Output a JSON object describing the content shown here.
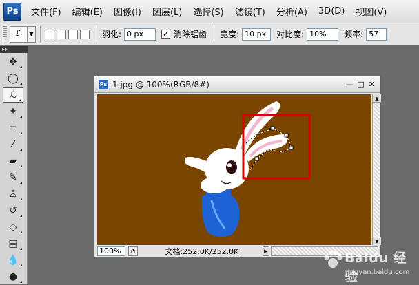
{
  "app": {
    "logo": "Ps"
  },
  "menu": [
    "文件(F)",
    "编辑(E)",
    "图像(I)",
    "图层(L)",
    "选择(S)",
    "滤镜(T)",
    "分析(A)",
    "3D(D)",
    "视图(V)"
  ],
  "window_controls": {
    "minimize": "—",
    "maximize": "□",
    "close": "✕"
  },
  "options_bar": {
    "feather_label": "羽化:",
    "feather_value": "0 px",
    "antialias_label": "消除锯齿",
    "antialias_check": "✓",
    "width_label": "宽度:",
    "width_value": "10 px",
    "contrast_label": "对比度:",
    "contrast_value": "10%",
    "frequency_label": "频率:",
    "frequency_value": "57"
  },
  "tools": [
    {
      "name": "move-tool-icon",
      "glyph": "✥"
    },
    {
      "name": "marquee-tool-icon",
      "glyph": "◯"
    },
    {
      "name": "magnetic-lasso-tool-icon",
      "glyph": "ℒ",
      "active": true
    },
    {
      "name": "magic-wand-tool-icon",
      "glyph": "✦"
    },
    {
      "name": "crop-tool-icon",
      "glyph": "⌗"
    },
    {
      "name": "eyedropper-tool-icon",
      "glyph": "⁄"
    },
    {
      "name": "healing-brush-tool-icon",
      "glyph": "▰"
    },
    {
      "name": "brush-tool-icon",
      "glyph": "✎"
    },
    {
      "name": "clone-stamp-tool-icon",
      "glyph": "♙"
    },
    {
      "name": "history-brush-tool-icon",
      "glyph": "↺"
    },
    {
      "name": "eraser-tool-icon",
      "glyph": "◇"
    },
    {
      "name": "gradient-tool-icon",
      "glyph": "▤"
    },
    {
      "name": "blur-tool-icon",
      "glyph": "💧"
    },
    {
      "name": "dodge-tool-icon",
      "glyph": "●"
    }
  ],
  "document": {
    "title": "1.jpg @ 100%(RGB/8#)",
    "canvas_color": "#7a4500",
    "selection_color": "#d80000",
    "zoom": "100%",
    "doc_info": "文档:252.0K/252.0K"
  },
  "watermark": {
    "brand": "Baidu 经验",
    "url": "jingyan.baidu.com"
  }
}
